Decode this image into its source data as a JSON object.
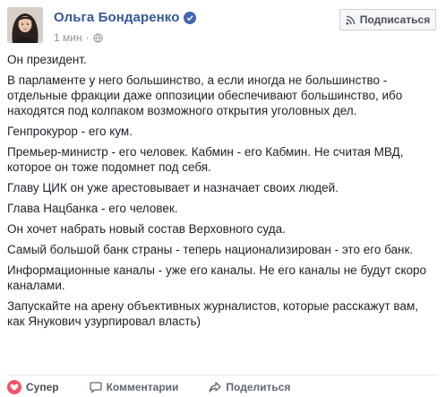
{
  "author": {
    "name": "Ольга Бондаренко",
    "verified_icon": "verified-badge-icon",
    "time": "1 мин",
    "separator": "·",
    "privacy_icon": "globe-icon"
  },
  "subscribe": {
    "label": "Подписаться",
    "icon": "rss-icon"
  },
  "post": {
    "paragraphs": [
      "Он президент.",
      "В парламенте у него большинство, а если иногда не большинство - отдельные фракции даже оппозиции обеспечивают большинство, ибо находятся под колпаком возможного открытия уголовных дел.",
      "Генпрокурор - его кум.",
      "Премьер-министр - его человек. Кабмин - его Кабмин. Не считая МВД, которое он тоже подомнет под себя.",
      "Главу ЦИК он уже арестовывает и назначает своих людей.",
      "Глава Нацбанка - его человек.",
      "Он хочет набрать новый состав Верховного суда.",
      "Самый большой банк страны - теперь национализирован - это его банк.",
      "Информационные каналы - уже его каналы. Не его каналы не будут скоро каналами.",
      "Запускайте на арену объективных журналистов, которые расскажут вам, как Янукович узурпировал власть)"
    ]
  },
  "actions": [
    {
      "label": "Супер",
      "icon": "heart-icon"
    },
    {
      "label": "Комментарии",
      "icon": "comment-icon"
    },
    {
      "label": "Поделиться",
      "icon": "share-icon"
    }
  ],
  "colors": {
    "accent": "#365899",
    "badge": "#4267b2",
    "super": "#f25268",
    "muted": "#90949c"
  }
}
